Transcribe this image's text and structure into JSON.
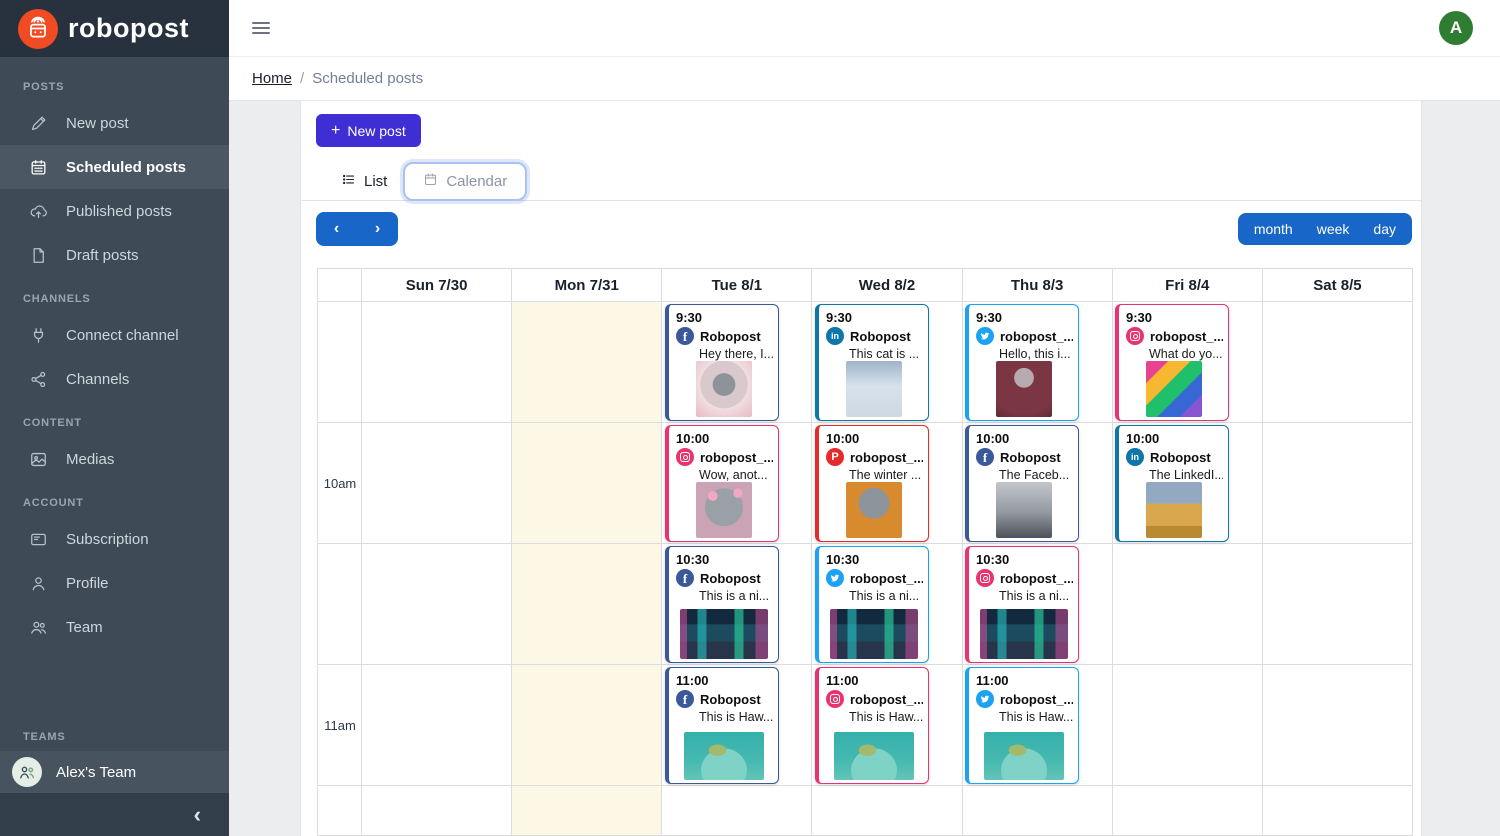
{
  "app": {
    "logo_text": "robopost"
  },
  "colors": {
    "logo_orange": "#f04b23",
    "accent_indigo": "#3e2ed4",
    "accent_blue": "#1766c8",
    "avatar_green": "#2e7d32",
    "today_bg": "#fdf8e6",
    "platforms": {
      "facebook": "#3b5998",
      "linkedin": "#0e76a8",
      "twitter": "#1da1f2",
      "instagram": "#e8336f",
      "pinterest": "#e62b2b"
    }
  },
  "sidebar": {
    "sections": [
      {
        "label": "POSTS",
        "items": [
          {
            "label": "New post",
            "icon": "pencil-icon",
            "active": false
          },
          {
            "label": "Scheduled posts",
            "icon": "calendar-icon",
            "active": true
          },
          {
            "label": "Published posts",
            "icon": "upload-cloud-icon",
            "active": false
          },
          {
            "label": "Draft posts",
            "icon": "draft-icon",
            "active": false
          }
        ]
      },
      {
        "label": "CHANNELS",
        "items": [
          {
            "label": "Connect channel",
            "icon": "plug-icon",
            "active": false
          },
          {
            "label": "Channels",
            "icon": "share-icon",
            "active": false
          }
        ]
      },
      {
        "label": "CONTENT",
        "items": [
          {
            "label": "Medias",
            "icon": "media-icon",
            "active": false
          }
        ]
      },
      {
        "label": "ACCOUNT",
        "items": [
          {
            "label": "Subscription",
            "icon": "subscription-icon",
            "active": false
          },
          {
            "label": "Profile",
            "icon": "user-icon",
            "active": false
          },
          {
            "label": "Team",
            "icon": "users-icon",
            "active": false
          }
        ]
      }
    ],
    "teams_label": "TEAMS",
    "team_name": "Alex's Team"
  },
  "topbar": {
    "avatar_letter": "A"
  },
  "breadcrumb": {
    "home": "Home",
    "separator": "/",
    "current": "Scheduled posts"
  },
  "toolbar": {
    "new_post": {
      "plus": "+",
      "label": "New post"
    },
    "tabs": [
      {
        "label": "List",
        "icon": "list-icon",
        "active": false
      },
      {
        "label": "Calendar",
        "icon": "tab-calendar-icon",
        "active": true
      }
    ],
    "nav_prev": "‹",
    "nav_next": "›",
    "views": [
      "month",
      "week",
      "day"
    ]
  },
  "calendar": {
    "days": [
      "Sun 7/30",
      "Mon 7/31",
      "Tue 8/1",
      "Wed 8/2",
      "Thu 8/3",
      "Fri 8/4",
      "Sat 8/5"
    ],
    "today_index": 1,
    "time_rows": [
      "",
      "10am",
      "",
      "11am",
      ""
    ],
    "events": [
      {
        "day": 2,
        "slot": 0,
        "time": "9:30",
        "platform": "facebook",
        "account": "Robopost",
        "caption": "Hey there, I...",
        "image": "cat-snowglobe"
      },
      {
        "day": 3,
        "slot": 0,
        "time": "9:30",
        "platform": "linkedin",
        "account": "Robopost",
        "caption": "This cat is ...",
        "image": "cat-snow"
      },
      {
        "day": 4,
        "slot": 0,
        "time": "9:30",
        "platform": "twitter",
        "account": "robopost_...",
        "caption": "Hello, this i...",
        "image": "cat-robe"
      },
      {
        "day": 5,
        "slot": 0,
        "time": "9:30",
        "platform": "instagram",
        "account": "robopost_...",
        "caption": "What do yo...",
        "image": "cat-rainbow"
      },
      {
        "day": 2,
        "slot": 1,
        "time": "10:00",
        "platform": "instagram",
        "account": "robopost_...",
        "caption": "Wow, anot...",
        "image": "cat-bowtie"
      },
      {
        "day": 3,
        "slot": 1,
        "time": "10:00",
        "platform": "pinterest",
        "account": "robopost_...",
        "caption": "The winter ...",
        "image": "cat-scarf"
      },
      {
        "day": 4,
        "slot": 1,
        "time": "10:00",
        "platform": "facebook",
        "account": "Robopost",
        "caption": "The Faceb...",
        "image": "cat-gray"
      },
      {
        "day": 5,
        "slot": 1,
        "time": "10:00",
        "platform": "linkedin",
        "account": "Robopost",
        "caption": "The LinkedI...",
        "image": "cat-box"
      },
      {
        "day": 2,
        "slot": 2,
        "time": "10:30",
        "platform": "facebook",
        "account": "Robopost",
        "caption": "This is a ni...",
        "image": "neon-city"
      },
      {
        "day": 3,
        "slot": 2,
        "time": "10:30",
        "platform": "twitter",
        "account": "robopost_...",
        "caption": "This is a ni...",
        "image": "neon-city"
      },
      {
        "day": 4,
        "slot": 2,
        "time": "10:30",
        "platform": "instagram",
        "account": "robopost_...",
        "caption": "This is a ni...",
        "image": "neon-city"
      },
      {
        "day": 2,
        "slot": 3,
        "time": "11:00",
        "platform": "facebook",
        "account": "Robopost",
        "caption": "This is Haw...",
        "image": "turtle-sea"
      },
      {
        "day": 3,
        "slot": 3,
        "time": "11:00",
        "platform": "instagram",
        "account": "robopost_...",
        "caption": "This is Haw...",
        "image": "turtle-sea"
      },
      {
        "day": 4,
        "slot": 3,
        "time": "11:00",
        "platform": "twitter",
        "account": "robopost_...",
        "caption": "This is Haw...",
        "image": "turtle-sea"
      }
    ]
  }
}
